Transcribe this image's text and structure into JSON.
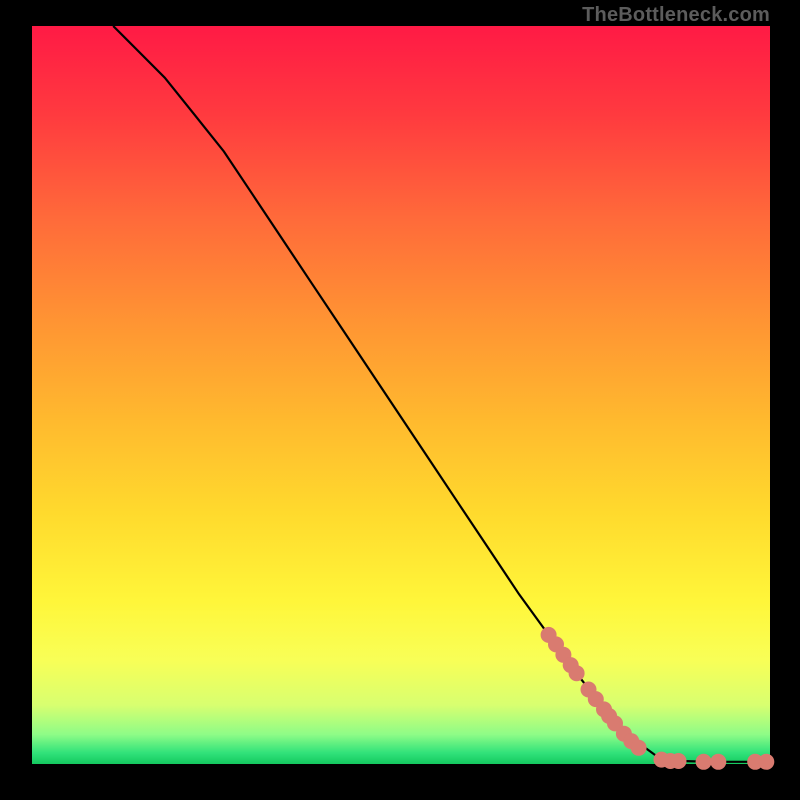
{
  "watermark": "TheBottleneck.com",
  "chart_data": {
    "type": "line",
    "title": "",
    "xlabel": "",
    "ylabel": "",
    "xlim": [
      0,
      100
    ],
    "ylim": [
      0,
      100
    ],
    "grid": false,
    "legend": false,
    "curve": {
      "comment": "Monotone decreasing curve from (x≈11, y=100) down to (x≈85, y≈0) then flat along y=0 to x≈100. Values are percentage coordinates inside the plot box.",
      "points": [
        [
          11,
          100
        ],
        [
          14,
          97
        ],
        [
          18,
          93
        ],
        [
          22,
          88
        ],
        [
          26,
          83
        ],
        [
          30,
          77
        ],
        [
          34,
          71
        ],
        [
          38,
          65
        ],
        [
          42,
          59
        ],
        [
          46,
          53
        ],
        [
          50,
          47
        ],
        [
          54,
          41
        ],
        [
          58,
          35
        ],
        [
          62,
          29
        ],
        [
          66,
          23
        ],
        [
          70,
          17.5
        ],
        [
          74,
          12
        ],
        [
          78,
          7
        ],
        [
          82,
          3
        ],
        [
          85,
          0.8
        ],
        [
          88,
          0.4
        ],
        [
          92,
          0.3
        ],
        [
          96,
          0.3
        ],
        [
          100,
          0.3
        ]
      ]
    },
    "markers": {
      "comment": "Salmon-colored round markers clustered on lower-right portion of curve.",
      "color": "#d97b70",
      "radius_px": 8,
      "points": [
        [
          70.0,
          17.5
        ],
        [
          71.0,
          16.2
        ],
        [
          72.0,
          14.8
        ],
        [
          73.0,
          13.4
        ],
        [
          73.8,
          12.3
        ],
        [
          75.4,
          10.1
        ],
        [
          76.4,
          8.8
        ],
        [
          77.5,
          7.4
        ],
        [
          78.2,
          6.5
        ],
        [
          79.0,
          5.5
        ],
        [
          80.2,
          4.1
        ],
        [
          81.2,
          3.1
        ],
        [
          82.2,
          2.2
        ],
        [
          85.3,
          0.6
        ],
        [
          86.5,
          0.4
        ],
        [
          87.6,
          0.4
        ],
        [
          91.0,
          0.3
        ],
        [
          93.0,
          0.3
        ],
        [
          98.0,
          0.3
        ],
        [
          99.5,
          0.3
        ]
      ]
    }
  }
}
